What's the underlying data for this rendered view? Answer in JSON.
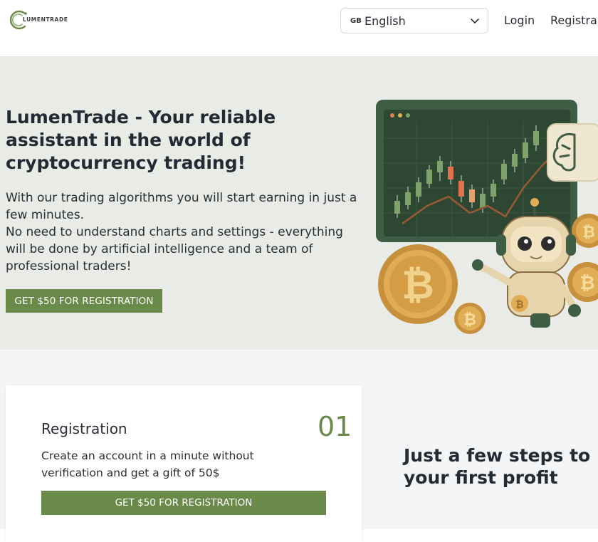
{
  "brand": {
    "logo_text": "LUMENTRADE"
  },
  "header": {
    "language": {
      "code": "GB",
      "label": "English"
    },
    "nav": {
      "login": "Login",
      "register": "Registra"
    }
  },
  "hero": {
    "title": "LumenTrade - Your reliable assistant in the world of cryptocurrency trading!",
    "paragraph1": "With our trading algorithms you will start earning in just a few minutes.",
    "paragraph2": "No need to understand charts and settings - everything will be done by artificial intelligence and a team of professional traders!",
    "cta": "GET $50 FOR REGISTRATION"
  },
  "steps": {
    "heading": "Just a few steps to your first profit",
    "items": [
      {
        "title": "Registration",
        "number": "01",
        "description": "Create an account in a minute without verification and get a gift of 50$",
        "cta": "GET $50 FOR REGISTRATION"
      }
    ]
  },
  "colors": {
    "accent": "#6a8a4a",
    "hero_bg": "#e8ebe6",
    "section_bg": "#f4f5f7",
    "text": "#222a33"
  },
  "icons": {
    "logo": "lumentrade-logo-icon",
    "chevron": "chevron-down-icon",
    "illustration": "robot-bitcoin-chart-illustration"
  }
}
